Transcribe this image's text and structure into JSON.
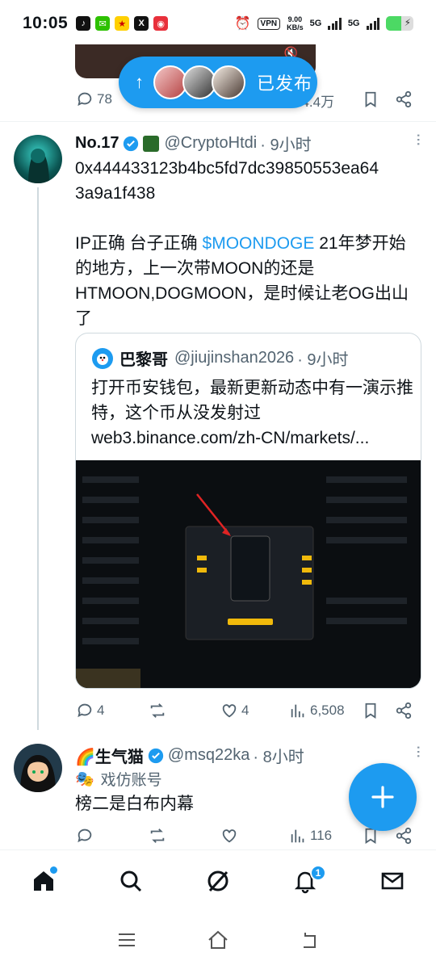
{
  "status_bar": {
    "time": "10:05",
    "vpn": "VPN",
    "speed_value": "9.00",
    "speed_unit": "KB/s",
    "net1": "5G",
    "net2": "5G"
  },
  "published_pill": {
    "label": "已发布"
  },
  "prev_tweet": {
    "replies": "78",
    "views": "14.4万"
  },
  "tweet1": {
    "name": "No.17",
    "handle": "@CryptoHtdi",
    "time": "· 9小时",
    "text_line1": "0x444433123b4bc5fd7dc39850553ea64",
    "text_line2": "3a9a1f438",
    "text_p2_a": "IP正确 台子正确 ",
    "cashtag": "$MOONDOGE",
    "text_p2_b": " 21年梦开始的地方，上一次带MOON的还是HTMOON,DOGMOON，是时候让老OG出山了",
    "quote": {
      "name": "巴黎哥",
      "handle": "@jiujinshan2026",
      "time": "· 9小时",
      "text": "打开币安钱包，最新更新动态中有一演示推特，这个币从没发射过",
      "link": "web3.binance.com/zh-CN/markets/..."
    },
    "replies": "4",
    "likes": "4",
    "views": "6,508"
  },
  "tweet2": {
    "name": "🌈生气猫",
    "handle": "@msq22ka",
    "time": "· 8小时",
    "label": "戏仿账号",
    "text": "榜二是白布内幕",
    "views": "116"
  },
  "nav": {
    "notif_count": "1"
  },
  "colors": {
    "accent": "#1d9bf0",
    "text": "#0f1419",
    "secondary": "#536471"
  }
}
